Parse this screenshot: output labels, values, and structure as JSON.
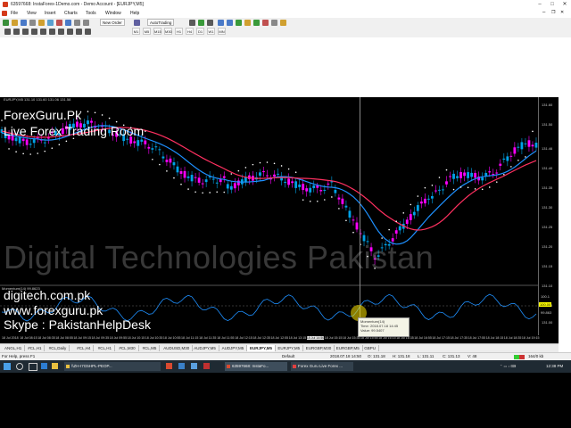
{
  "window": {
    "title": "63597668: InstaForex-1Demo.com - Demo Account - [EURJPY,M5]"
  },
  "menu": [
    "File",
    "View",
    "Insert",
    "Charts",
    "Tools",
    "Window",
    "Help"
  ],
  "toolbar": {
    "new_order": "New Order",
    "autotrading": "AutoTrading"
  },
  "timeframes": [
    "M1",
    "M5",
    "M15",
    "M30",
    "H1",
    "H4",
    "D1",
    "W1",
    "MN"
  ],
  "chart": {
    "symbol_info": "EURJPY,M5 131.10 131.60 131.06 131.58",
    "price_ticks": [
      "131.60",
      "131.50",
      "131.46",
      "131.40",
      "131.35",
      "131.30",
      "131.25",
      "131.20",
      "131.15",
      "131.10",
      "131.05",
      "131.00"
    ],
    "indicator_label": "Momentum(14) 99.8623",
    "indicator_ticks": [
      "100.1",
      "100.00",
      "99.863"
    ],
    "time_ticks": [
      "18 Jul 2018",
      "18 Jul 08:15",
      "18 Jul 08:35",
      "18 Jul 08:55",
      "18 Jul 09:15",
      "18 Jul 09:35",
      "18 Jul 09:55",
      "18 Jul 10:15",
      "18 Jul 10:35",
      "18 Jul 10:55",
      "18 Jul 11:15",
      "18 Jul 11:35",
      "18 Jul 11:55",
      "18 Jul 12:15",
      "18 Jul 12:35",
      "18 Jul 12:55",
      "18 Jul 13:15",
      "18 Jul 14:50",
      "18 Jul 15:15",
      "18 Jul 15:35",
      "18 Jul 15:55",
      "18 Jul 16:15",
      "18 Jul 16:35",
      "18 Jul 16:55",
      "18 Jul 17:15",
      "18 Jul 17:35",
      "18 Jul 17:55",
      "18 Jul 18:15",
      "18 Jul 18:35",
      "18 Jul 19:15"
    ],
    "colors": {
      "bull": "#00a2e8",
      "bear": "#ff00ff",
      "ma_fast": "#1e90ff",
      "ma_slow": "#ff3060",
      "sar": "#ffffff",
      "momentum": "#1e90ff"
    }
  },
  "overlay": {
    "brand1": "ForexGuru.Pk",
    "brand2": "Live Forex Trading Room",
    "watermark": "Digital Technologies Pakistan",
    "site1": "digitech.com.pk",
    "site2": "www.forexguru.pk",
    "skype": "Skype : PakistanHelpDesk"
  },
  "tooltip": {
    "line1": "Momentum(14)",
    "line2": "Time: 2018.07.18 14:45",
    "line3": "Value: 99.5407"
  },
  "tabs": [
    "ANGL,H1",
    "#CL,H1",
    "#CL,Daily",
    "#CL,H4",
    "#CL,H1",
    "#CL,M30",
    "#CL,M5",
    "AUDUSD,M30",
    "AUDJPY,M5",
    "AUDJPY,M5",
    "EURJPY,M5",
    "EURJPY,M5",
    "EURGBP,M30",
    "EURGBP,M5",
    "GBPU"
  ],
  "status": {
    "help": "For Help, press F1",
    "profile": "Default",
    "datetime": "2018.07.18 14:50",
    "open": "O: 131.18",
    "high": "H: 131.18",
    "low": "L: 131.11",
    "close": "C: 131.13",
    "volume": "V: 48",
    "traffic": "164/0 kb"
  },
  "taskbar": {
    "items": [
      "\\\\ZH-I7G5HPL-PEOP...",
      "63597668: InstaFo...",
      "Forex Guru Live Forex ..."
    ],
    "time": "12:38 PM"
  }
}
